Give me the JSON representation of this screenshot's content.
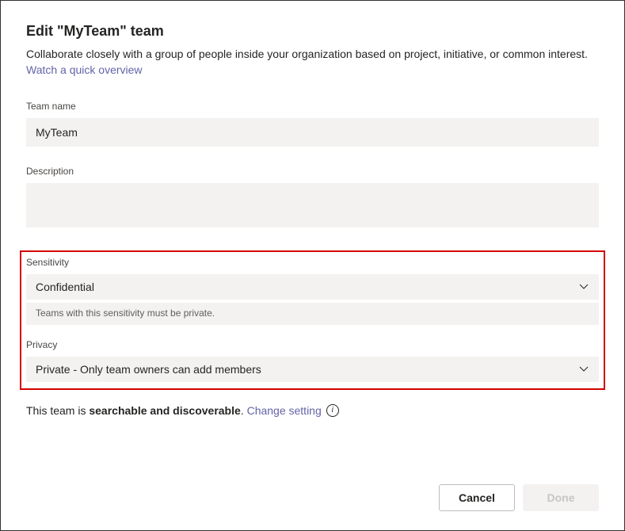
{
  "dialog": {
    "title": "Edit \"MyTeam\" team",
    "subtitle_prefix": "Collaborate closely with a group of people inside your organization based on project, initiative, or common interest. ",
    "overview_link": "Watch a quick overview"
  },
  "team_name": {
    "label": "Team name",
    "value": "MyTeam"
  },
  "description": {
    "label": "Description",
    "value": ""
  },
  "sensitivity": {
    "label": "Sensitivity",
    "value": "Confidential",
    "help": "Teams with this sensitivity must be private."
  },
  "privacy": {
    "label": "Privacy",
    "value": "Private - Only team owners can add members"
  },
  "discoverable": {
    "prefix": "This team is ",
    "bold": "searchable and discoverable",
    "suffix": ". ",
    "link": "Change setting"
  },
  "buttons": {
    "cancel": "Cancel",
    "done": "Done"
  }
}
